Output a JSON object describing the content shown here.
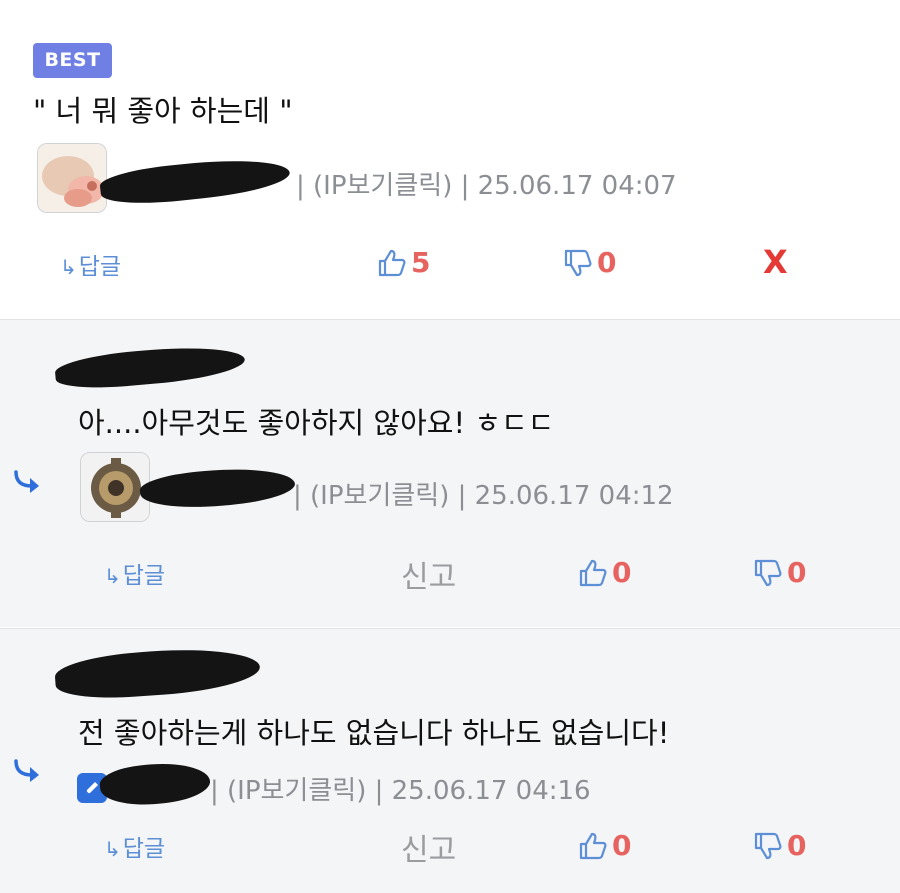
{
  "comments": [
    {
      "badge": "BEST",
      "text": "\" 너 뭐 좋아 하는데 \"",
      "meta": "| (IP보기클릭) | 25.06.17 04:07",
      "reply_label": "답글",
      "up": "5",
      "down": "0",
      "delete_label": "X"
    },
    {
      "text": "아....아무것도 좋아하지 않아요! ㅎㄷㄷ",
      "meta": "| (IP보기클릭) | 25.06.17 04:12",
      "reply_label": "답글",
      "report_label": "신고",
      "up": "0",
      "down": "0"
    },
    {
      "text": "전 좋아하는게 하나도 없습니다 하나도 없습니다!",
      "meta": "| (IP보기클릭) | 25.06.17 04:16",
      "reply_label": "답글",
      "report_label": "신고",
      "up": "0",
      "down": "0"
    }
  ],
  "icons": {
    "thumbs_up": "thumbs-up-icon",
    "thumbs_down": "thumbs-down-icon",
    "reply_arrow": "reply-arrow-icon",
    "write": "pencil-icon"
  },
  "colors": {
    "badge": "#6f7fe3",
    "link": "#5c8fd6",
    "vote_count": "#e6635f",
    "delete": "#e53935",
    "reply_indicator": "#2e6fdb"
  }
}
